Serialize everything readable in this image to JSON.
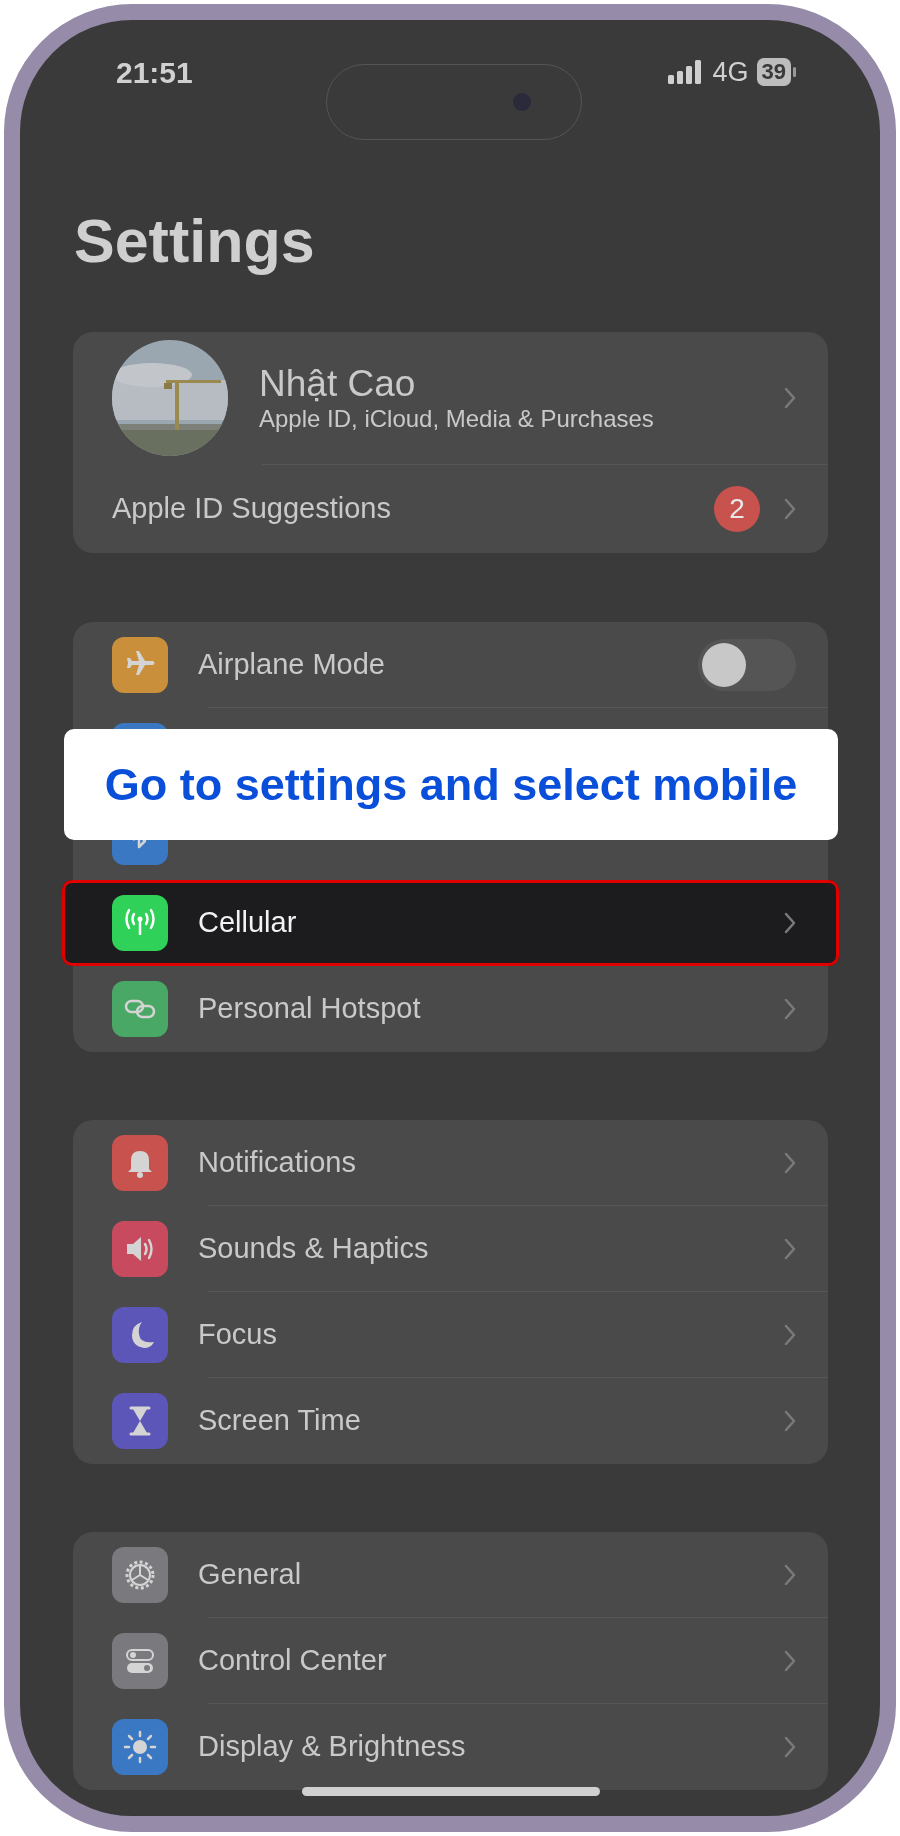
{
  "status_bar": {
    "time": "21:51",
    "network": "4G",
    "battery": "39"
  },
  "title": "Settings",
  "profile": {
    "name": "Nhật Cao",
    "subtitle": "Apple ID, iCloud, Media & Purchases"
  },
  "suggestions": {
    "label": "Apple ID Suggestions",
    "badge": "2"
  },
  "groups": [
    {
      "rows": [
        {
          "kind": "toggle",
          "color": "#c98f3a",
          "label": "Airplane Mode",
          "on": false,
          "selected": false
        },
        {
          "kind": "covered",
          "color": "#3b78c4",
          "selected": false
        },
        {
          "kind": "covered",
          "color": "#3b78c4",
          "selected": false
        },
        {
          "kind": "link",
          "color": "#2fd158",
          "label": "Cellular",
          "selected": true
        },
        {
          "kind": "link",
          "color": "#4aa866",
          "label": "Personal Hotspot",
          "selected": false
        }
      ]
    },
    {
      "rows": [
        {
          "kind": "link",
          "color": "#c8524e",
          "label": "Notifications",
          "selected": false
        },
        {
          "kind": "link",
          "color": "#c84a5e",
          "label": "Sounds & Haptics",
          "selected": false
        },
        {
          "kind": "link",
          "color": "#5c56b8",
          "label": "Focus",
          "selected": false
        },
        {
          "kind": "link",
          "color": "#5c56b8",
          "label": "Screen Time",
          "selected": false
        }
      ]
    },
    {
      "rows": [
        {
          "kind": "link",
          "color": "#7a7a7e",
          "label": "General",
          "selected": false
        },
        {
          "kind": "link",
          "color": "#7a7a7e",
          "label": "Control Center",
          "selected": false
        },
        {
          "kind": "link",
          "color": "#3b78c4",
          "label": "Display & Brightness",
          "selected": false
        }
      ]
    }
  ],
  "callout": {
    "text": "Go to settings and select mobile"
  }
}
